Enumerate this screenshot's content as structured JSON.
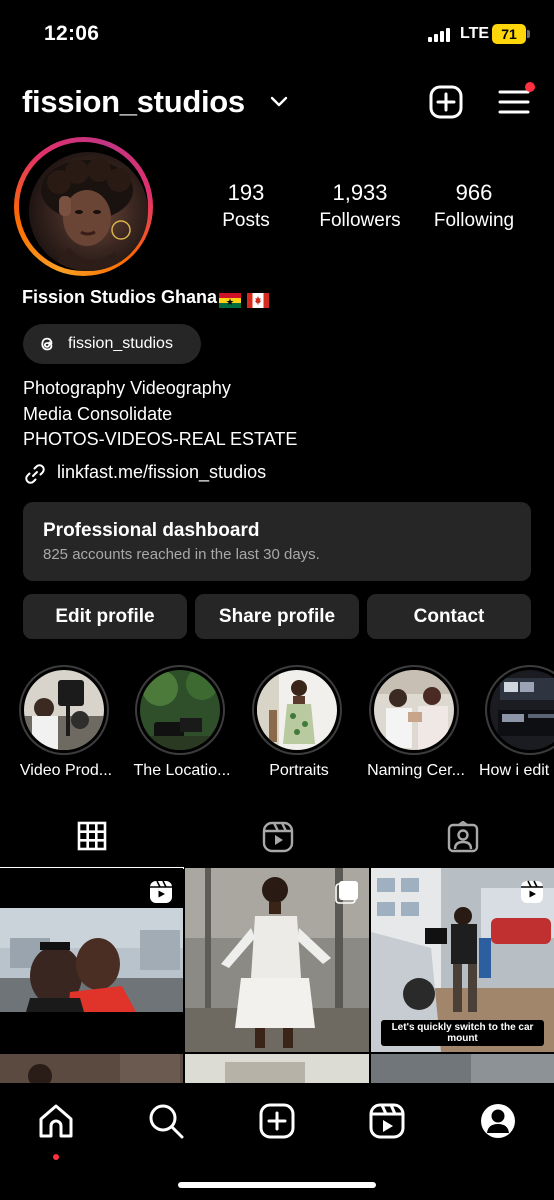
{
  "status_bar": {
    "time": "12:06",
    "network": "LTE",
    "battery": "71"
  },
  "header": {
    "username": "fission_studios",
    "icons": [
      "chevron-down-icon",
      "plus-square-icon",
      "menu-icon"
    ],
    "notification_color": "#ff3040"
  },
  "profile": {
    "stats": [
      {
        "value": "193",
        "label": "Posts"
      },
      {
        "value": "1,933",
        "label": "Followers"
      },
      {
        "value": "966",
        "label": "Following"
      }
    ],
    "display_name": "Fission Studios Ghana",
    "flags": [
      "ghana-flag",
      "canada-flag"
    ],
    "threads_handle": "fission_studios",
    "bio_lines": [
      "Photography Videography",
      "Media Consolidate",
      "PHOTOS-VIDEOS-REAL ESTATE"
    ],
    "link": "linkfast.me/fission_studios"
  },
  "dashboard": {
    "title": "Professional dashboard",
    "subtitle": "825 accounts reached in the last 30 days."
  },
  "buttons": {
    "edit": "Edit profile",
    "share": "Share profile",
    "contact": "Contact"
  },
  "highlights": [
    {
      "label": "Video Prod..."
    },
    {
      "label": "The Locatio..."
    },
    {
      "label": "Portraits"
    },
    {
      "label": "Naming Cer..."
    },
    {
      "label": "How i edit"
    }
  ],
  "tabs": [
    {
      "name": "grid",
      "icon": "grid-icon",
      "selected": true
    },
    {
      "name": "reels",
      "icon": "reels-icon",
      "selected": false
    },
    {
      "name": "tagged",
      "icon": "tagged-icon",
      "selected": false
    }
  ],
  "grid": {
    "overlay_text": "Let's quickly switch to the car mount"
  },
  "bottom_nav": {
    "icons": [
      "home-icon",
      "search-icon",
      "create-icon",
      "reels-icon",
      "profile-icon"
    ],
    "active": "home"
  },
  "colors": {
    "background": "#000000",
    "card": "#262626",
    "muted_text": "#a8a8a8",
    "accent_red": "#ff3040",
    "battery": "#ffd60a"
  }
}
